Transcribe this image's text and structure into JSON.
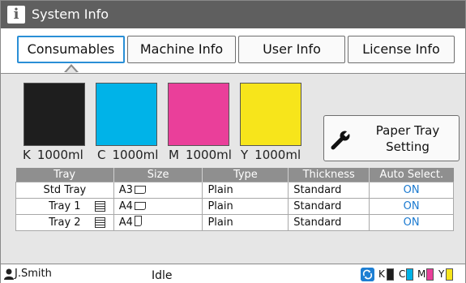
{
  "window": {
    "title": "System Info"
  },
  "tabs": [
    {
      "label": "Consumables",
      "active": true
    },
    {
      "label": "Machine Info",
      "active": false
    },
    {
      "label": "User Info",
      "active": false
    },
    {
      "label": "License Info",
      "active": false
    }
  ],
  "inks": [
    {
      "channel": "K",
      "amount": "1000ml",
      "color": "#1e1e1e"
    },
    {
      "channel": "C",
      "amount": "1000ml",
      "color": "#00b3e8"
    },
    {
      "channel": "M",
      "amount": "1000ml",
      "color": "#ea3f9a"
    },
    {
      "channel": "Y",
      "amount": "1000ml",
      "color": "#f7e51b"
    }
  ],
  "paper_tray_button": {
    "line1": "Paper Tray",
    "line2": "Setting",
    "icon": "wrench-icon"
  },
  "table": {
    "headers": [
      "Tray",
      "Size",
      "Type",
      "Thickness",
      "Auto Select."
    ],
    "rows": [
      {
        "tray": "Std Tray",
        "list_icon": false,
        "size": "A3",
        "orientation": "landscape",
        "type": "Plain",
        "thickness": "Standard",
        "auto": "ON"
      },
      {
        "tray": "Tray 1",
        "list_icon": true,
        "size": "A4",
        "orientation": "landscape",
        "type": "Plain",
        "thickness": "Standard",
        "auto": "ON"
      },
      {
        "tray": "Tray 2",
        "list_icon": true,
        "size": "A4",
        "orientation": "portrait",
        "type": "Plain",
        "thickness": "Standard",
        "auto": "ON"
      }
    ]
  },
  "status": {
    "user": "J.Smith",
    "state": "Idle",
    "ink_levels": [
      {
        "channel": "K",
        "color": "#1e1e1e"
      },
      {
        "channel": "C",
        "color": "#00b3e8"
      },
      {
        "channel": "M",
        "color": "#ea3f9a"
      },
      {
        "channel": "Y",
        "color": "#f7e51b"
      }
    ]
  },
  "colors": {
    "accent": "#2a8fd6",
    "on_text": "#1b7ad0",
    "titlebar": "#5f5f5f",
    "header": "#8f8f8f"
  }
}
